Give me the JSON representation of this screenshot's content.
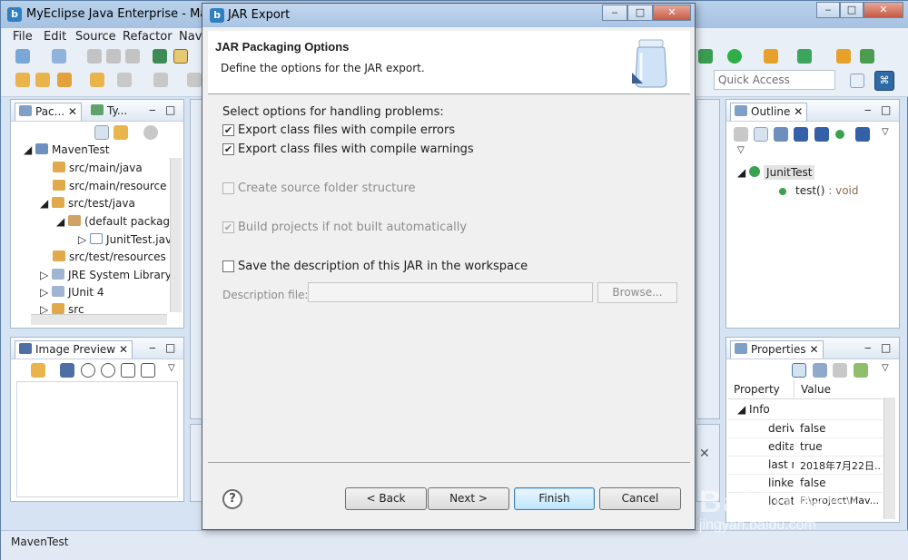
{
  "ide": {
    "title": "MyEclipse Java Enterprise - Maven",
    "menu": [
      "File",
      "Edit",
      "Source",
      "Refactor",
      "Navi"
    ],
    "quick_access": "Quick Access",
    "status": "MavenTest"
  },
  "package_explorer": {
    "tabs": [
      "Pac...",
      "Ty..."
    ],
    "items": [
      {
        "label": "MavenTest",
        "level": 0,
        "expanded": true
      },
      {
        "label": "src/main/java",
        "level": 1
      },
      {
        "label": "src/main/resource",
        "level": 1
      },
      {
        "label": "src/test/java",
        "level": 1,
        "expanded": true
      },
      {
        "label": "(default packag",
        "level": 2,
        "expanded": true
      },
      {
        "label": "JunitTest.jav",
        "level": 3
      },
      {
        "label": "src/test/resources",
        "level": 1
      },
      {
        "label": "JRE System Library",
        "level": 1
      },
      {
        "label": "JUnit 4",
        "level": 1
      },
      {
        "label": "src",
        "level": 1
      }
    ]
  },
  "image_preview": {
    "tab": "Image Preview"
  },
  "outline": {
    "tab": "Outline",
    "class_name": "JunitTest",
    "method": "test()",
    "method_type": " : void"
  },
  "properties": {
    "tab": "Properties",
    "headers": [
      "Property",
      "Value"
    ],
    "group": "Info",
    "rows": [
      {
        "key": "deriv",
        "value": "false"
      },
      {
        "key": "edita",
        "value": "true"
      },
      {
        "key": "last n",
        "value": "2018年7月22日..."
      },
      {
        "key": "linkec",
        "value": "false"
      },
      {
        "key": "locati",
        "value": "F:\\project\\Mav..."
      }
    ]
  },
  "dialog": {
    "title": "JAR Export",
    "banner_title": "JAR Packaging Options",
    "banner_desc": "Define the options for the JAR export.",
    "section_label": "Select options for handling problems:",
    "options": {
      "compile_errors": {
        "label": "Export class files with compile errors",
        "checked": true
      },
      "compile_warnings": {
        "label": "Export class files with compile warnings",
        "checked": true
      },
      "source_folder": {
        "label": "Create source folder structure",
        "checked": false
      },
      "build_projects": {
        "label": "Build projects if not built automatically",
        "checked": true
      },
      "save_description": {
        "label": "Save the description of this JAR in the workspace",
        "checked": false
      }
    },
    "description_file_label": "Description file:",
    "description_file_value": "",
    "browse_label": "Browse...",
    "back_label": "< Back",
    "next_label": "Next >",
    "finish_label": "Finish",
    "cancel_label": "Cancel"
  },
  "watermark": {
    "main": "Baidu经验",
    "sub": "jingyan.baidu.com"
  },
  "colors": {
    "accent": "#3c7fb1",
    "title_bar": "#a9c4e4",
    "disabled_text": "#8c8c8c"
  }
}
